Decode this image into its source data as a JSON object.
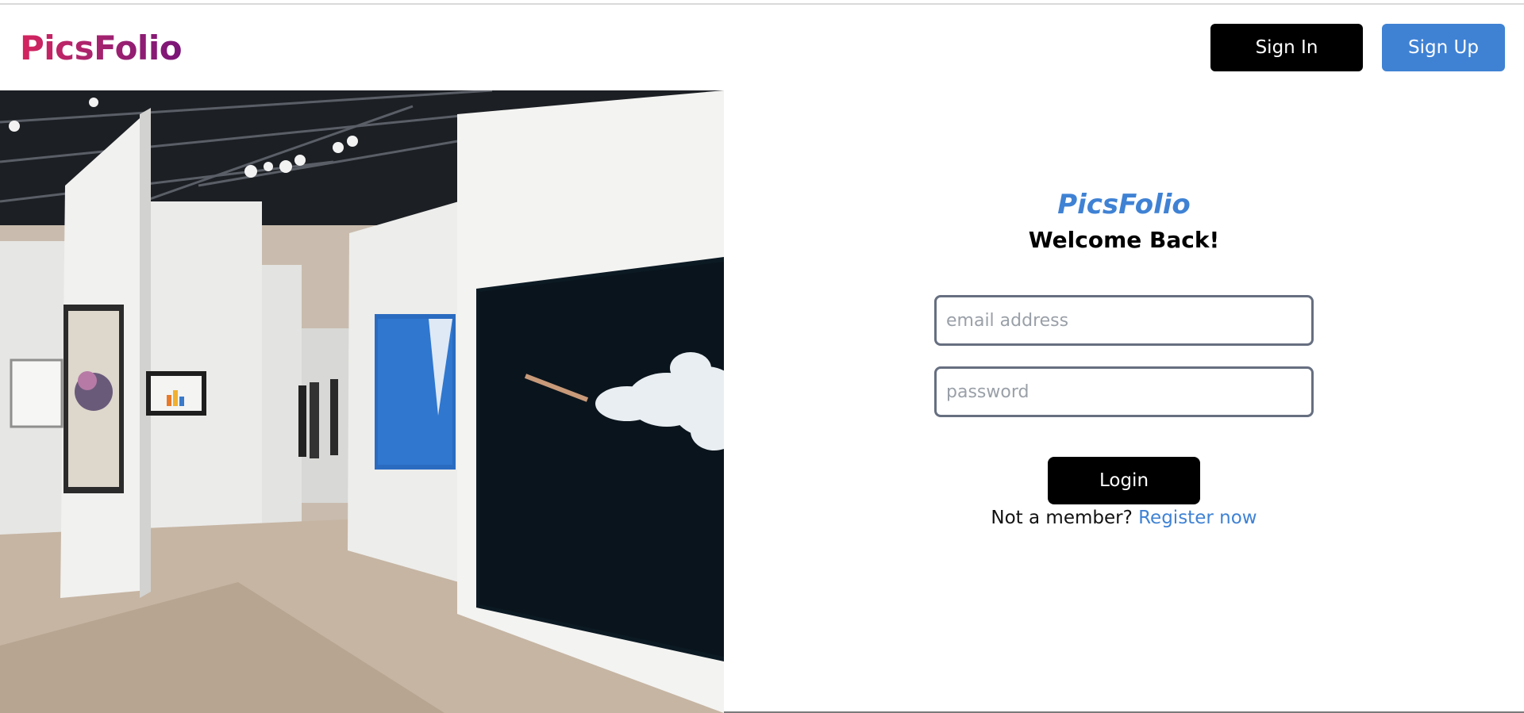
{
  "header": {
    "brand": "PicsFolio",
    "sign_in_label": "Sign In",
    "sign_up_label": "Sign Up"
  },
  "hero": {
    "description_icon": "art-gallery-photo"
  },
  "login": {
    "brand": "PicsFolio",
    "title": "Welcome Back!",
    "email_placeholder": "email address",
    "email_value": "",
    "password_placeholder": "password",
    "password_value": "",
    "login_label": "Login",
    "not_member_text": "Not a member?",
    "register_label": "Register now"
  },
  "colors": {
    "accent_blue": "#3f82d4",
    "brand_gradient_start": "#d6245e",
    "brand_gradient_end": "#7a1478",
    "button_dark": "#000000"
  }
}
